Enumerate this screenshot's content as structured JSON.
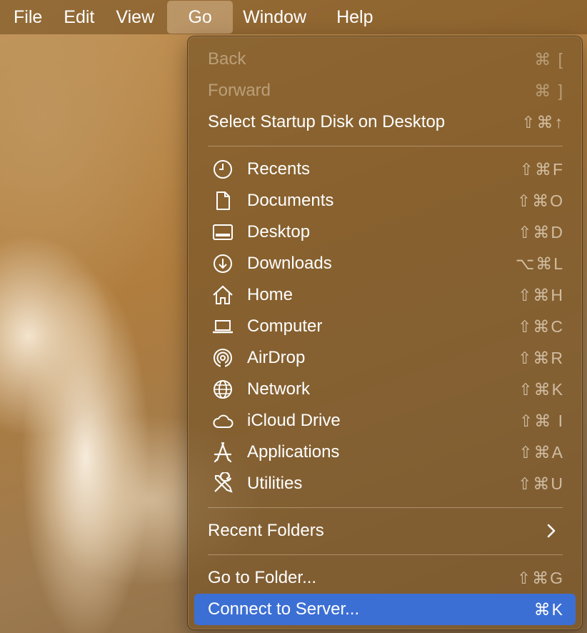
{
  "menubar": {
    "items": [
      {
        "label": "File"
      },
      {
        "label": "Edit"
      },
      {
        "label": "View"
      },
      {
        "label": "Go"
      },
      {
        "label": "Window"
      },
      {
        "label": "Help"
      }
    ]
  },
  "go_menu": {
    "back": {
      "label": "Back",
      "shortcut": "⌘ ["
    },
    "forward": {
      "label": "Forward",
      "shortcut": "⌘ ]"
    },
    "startup_disk": {
      "label": "Select Startup Disk on Desktop",
      "shortcut": "⇧⌘↑"
    },
    "recents": {
      "label": "Recents",
      "shortcut": "⇧⌘F",
      "icon": "clock-icon"
    },
    "documents": {
      "label": "Documents",
      "shortcut": "⇧⌘O",
      "icon": "document-icon"
    },
    "desktop": {
      "label": "Desktop",
      "shortcut": "⇧⌘D",
      "icon": "desktop-icon"
    },
    "downloads": {
      "label": "Downloads",
      "shortcut": "⌥⌘L",
      "icon": "download-icon"
    },
    "home": {
      "label": "Home",
      "shortcut": "⇧⌘H",
      "icon": "home-icon"
    },
    "computer": {
      "label": "Computer",
      "shortcut": "⇧⌘C",
      "icon": "laptop-icon"
    },
    "airdrop": {
      "label": "AirDrop",
      "shortcut": "⇧⌘R",
      "icon": "airdrop-icon"
    },
    "network": {
      "label": "Network",
      "shortcut": "⇧⌘K",
      "icon": "globe-icon"
    },
    "icloud": {
      "label": "iCloud Drive",
      "shortcut": "⇧⌘ I",
      "icon": "cloud-icon"
    },
    "applications": {
      "label": "Applications",
      "shortcut": "⇧⌘A",
      "icon": "applications-icon"
    },
    "utilities": {
      "label": "Utilities",
      "shortcut": "⇧⌘U",
      "icon": "tools-icon"
    },
    "recent_folders": {
      "label": "Recent Folders"
    },
    "go_to_folder": {
      "label": "Go to Folder...",
      "shortcut": "⇧⌘G"
    },
    "connect_to_server": {
      "label": "Connect to Server...",
      "shortcut": "⌘K"
    }
  },
  "colors": {
    "selection": "#3c6fd4"
  }
}
